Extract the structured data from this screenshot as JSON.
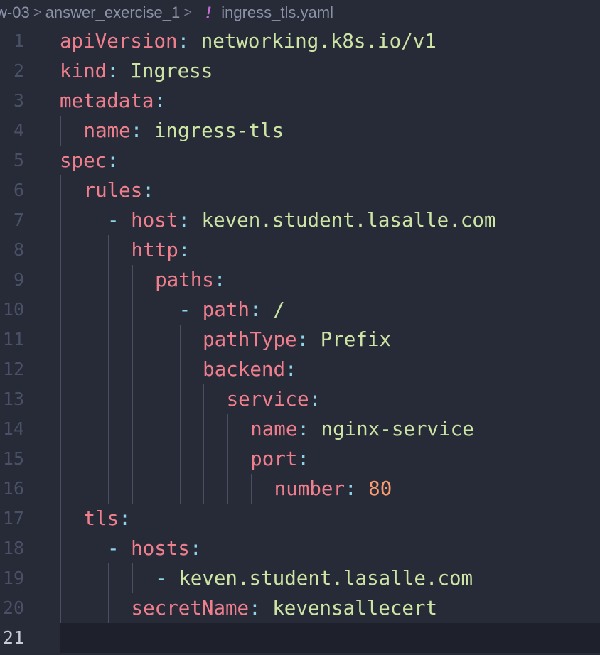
{
  "breadcrumb": {
    "segments": [
      "w-03",
      "answer_exercise_1"
    ],
    "file_icon": "!",
    "file_name": "ingress_tls.yaml",
    "separator": ">"
  },
  "editor": {
    "current_line": 21,
    "lines": [
      {
        "num": "1",
        "indent": 0,
        "dash": "",
        "key": "apiVersion",
        "colon": ":",
        "value": "networking.k8s.io/v1",
        "vtype": "s"
      },
      {
        "num": "2",
        "indent": 0,
        "dash": "",
        "key": "kind",
        "colon": ":",
        "value": "Ingress",
        "vtype": "s"
      },
      {
        "num": "3",
        "indent": 0,
        "dash": "",
        "key": "metadata",
        "colon": ":",
        "value": "",
        "vtype": "s"
      },
      {
        "num": "4",
        "indent": 1,
        "dash": "",
        "key": "name",
        "colon": ":",
        "value": "ingress-tls",
        "vtype": "s"
      },
      {
        "num": "5",
        "indent": 0,
        "dash": "",
        "key": "spec",
        "colon": ":",
        "value": "",
        "vtype": "s"
      },
      {
        "num": "6",
        "indent": 1,
        "dash": "",
        "key": "rules",
        "colon": ":",
        "value": "",
        "vtype": "s"
      },
      {
        "num": "7",
        "indent": 2,
        "dash": "-",
        "key": "host",
        "colon": ":",
        "value": "keven.student.lasalle.com",
        "vtype": "s"
      },
      {
        "num": "8",
        "indent": 3,
        "dash": "",
        "key": "http",
        "colon": ":",
        "value": "",
        "vtype": "s"
      },
      {
        "num": "9",
        "indent": 4,
        "dash": "",
        "key": "paths",
        "colon": ":",
        "value": "",
        "vtype": "s"
      },
      {
        "num": "10",
        "indent": 5,
        "dash": "-",
        "key": "path",
        "colon": ":",
        "value": "/",
        "vtype": "s"
      },
      {
        "num": "11",
        "indent": 6,
        "dash": "",
        "key": "pathType",
        "colon": ":",
        "value": "Prefix",
        "vtype": "s"
      },
      {
        "num": "12",
        "indent": 6,
        "dash": "",
        "key": "backend",
        "colon": ":",
        "value": "",
        "vtype": "s"
      },
      {
        "num": "13",
        "indent": 7,
        "dash": "",
        "key": "service",
        "colon": ":",
        "value": "",
        "vtype": "s"
      },
      {
        "num": "14",
        "indent": 8,
        "dash": "",
        "key": "name",
        "colon": ":",
        "value": "nginx-service",
        "vtype": "s"
      },
      {
        "num": "15",
        "indent": 8,
        "dash": "",
        "key": "port",
        "colon": ":",
        "value": "",
        "vtype": "s"
      },
      {
        "num": "16",
        "indent": 9,
        "dash": "",
        "key": "number",
        "colon": ":",
        "value": "80",
        "vtype": "n"
      },
      {
        "num": "17",
        "indent": 1,
        "dash": "",
        "key": "tls",
        "colon": ":",
        "value": "",
        "vtype": "s"
      },
      {
        "num": "18",
        "indent": 2,
        "dash": "-",
        "key": "hosts",
        "colon": ":",
        "value": "",
        "vtype": "s"
      },
      {
        "num": "19",
        "indent": 4,
        "dash": "-",
        "key": "",
        "colon": "",
        "value": "keven.student.lasalle.com",
        "vtype": "s"
      },
      {
        "num": "20",
        "indent": 3,
        "dash": "",
        "key": "secretName",
        "colon": ":",
        "value": "kevensallecert",
        "vtype": "s"
      },
      {
        "num": "21",
        "indent": 0,
        "dash": "",
        "key": "",
        "colon": "",
        "value": "",
        "vtype": "s"
      }
    ]
  },
  "colors": {
    "background": "#272a37",
    "key": "#f07f8e",
    "string": "#cde4a4",
    "punctuation": "#8fd6ec",
    "number": "#f79b72",
    "line_number": "#4a5066"
  }
}
